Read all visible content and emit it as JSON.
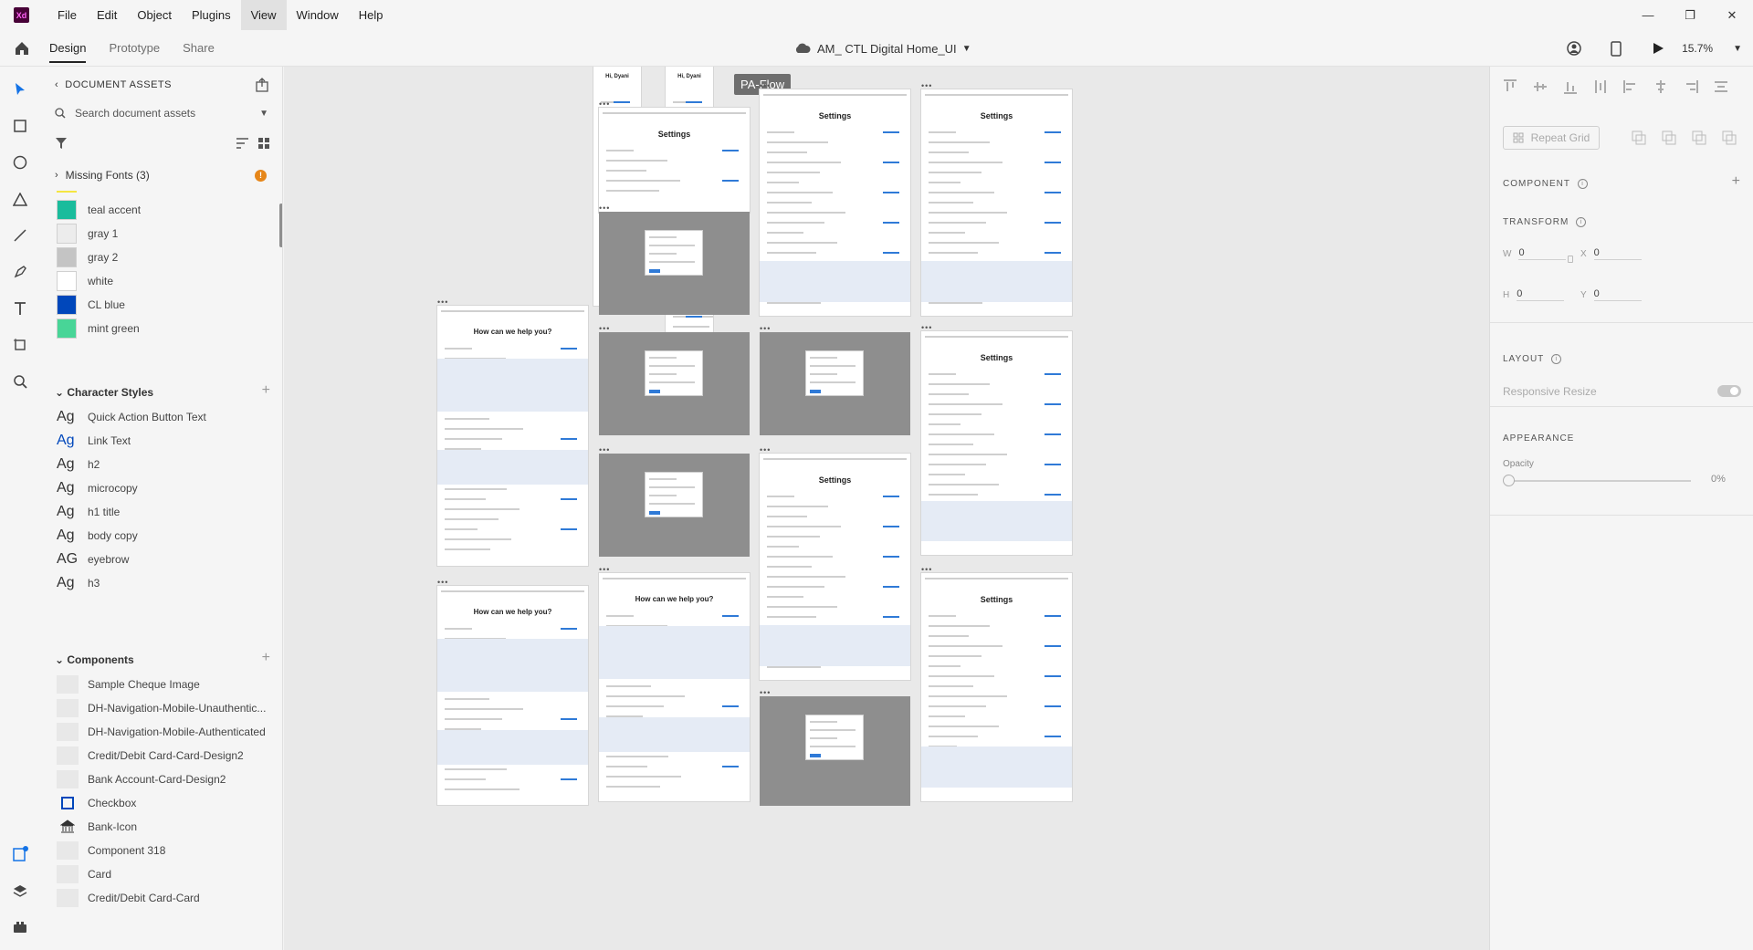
{
  "app": {
    "logo_text": "Xd"
  },
  "menu": [
    "File",
    "Edit",
    "Object",
    "Plugins",
    "View",
    "Window",
    "Help"
  ],
  "menu_active": "View",
  "toolbar": {
    "tabs": [
      "Design",
      "Prototype",
      "Share"
    ],
    "active_tab": "Design",
    "doc_title": "AM_ CTL Digital Home_UI",
    "zoom": "15.7%"
  },
  "assets": {
    "header": "DOCUMENT ASSETS",
    "search_placeholder": "Search document assets",
    "missing_fonts": "Missing Fonts (3)",
    "colors": [
      {
        "name": "teal accent",
        "hex": "#1abc9c"
      },
      {
        "name": "gray 1",
        "hex": "#ececec"
      },
      {
        "name": "gray 2",
        "hex": "#c4c4c4"
      },
      {
        "name": "white",
        "hex": "#ffffff"
      },
      {
        "name": "CL blue",
        "hex": "#0047bb"
      },
      {
        "name": "mint green",
        "hex": "#48d597"
      }
    ],
    "character_styles_title": "Character Styles",
    "character_styles": [
      {
        "sample": "Ag",
        "name": "Quick Action Button Text"
      },
      {
        "sample": "Ag",
        "name": "Link Text"
      },
      {
        "sample": "Ag",
        "name": "h2"
      },
      {
        "sample": "Ag",
        "name": "microcopy"
      },
      {
        "sample": "Ag",
        "name": "h1 title"
      },
      {
        "sample": "Ag",
        "name": "body copy"
      },
      {
        "sample": "AG",
        "name": "eyebrow"
      },
      {
        "sample": "Ag",
        "name": "h3"
      }
    ],
    "components_title": "Components",
    "components": [
      "Sample Cheque Image",
      "DH-Navigation-Mobile-Unauthentic...",
      "DH-Navigation-Mobile-Authenticated",
      "Credit/Debit Card-Card-Design2",
      "Bank Account-Card-Design2",
      "Checkbox",
      "Bank-Icon",
      "Component 318",
      "Card",
      "Credit/Debit Card-Card"
    ]
  },
  "canvas": {
    "flow_label": "PA-Flow",
    "artboard_titles": {
      "settings": "Settings",
      "help": "How can we help you?",
      "hi": "Hi, Dyani"
    }
  },
  "props": {
    "repeat_grid": "Repeat Grid",
    "component": "COMPONENT",
    "transform": "TRANSFORM",
    "w_label": "W",
    "w_value": "0",
    "h_label": "H",
    "h_value": "0",
    "x_label": "X",
    "x_value": "0",
    "y_label": "Y",
    "y_value": "0",
    "layout": "LAYOUT",
    "responsive_resize": "Responsive Resize",
    "appearance": "APPEARANCE",
    "opacity_label": "Opacity",
    "opacity_value": "0%"
  }
}
